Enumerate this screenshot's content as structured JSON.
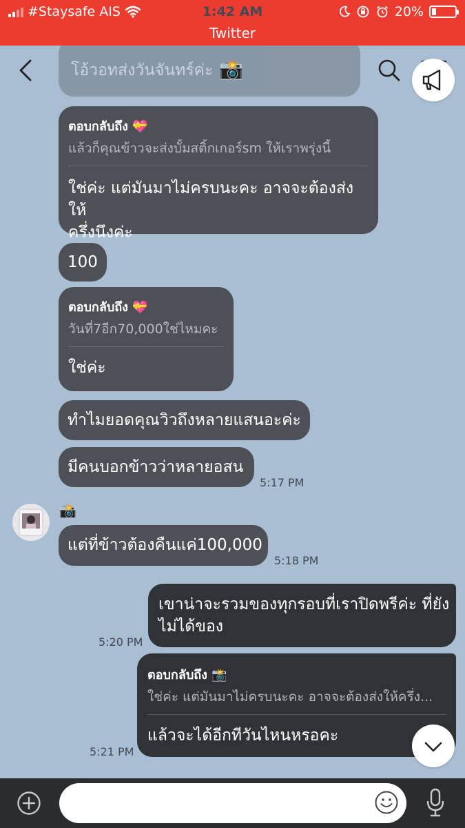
{
  "status_bar": {
    "carrier": "#Staysafe AIS",
    "time": "1:42 AM",
    "app": "Twitter",
    "battery": "20%",
    "battery_level": 0.2
  },
  "chat_title": "📸",
  "messages": [
    {
      "text": "โอ้วอทส่งวันจันทร์ค่ะ"
    },
    {
      "reply_label": "ตอบกลับถึง 💝",
      "quote": "แล้วก็คุณข้าวจะส่งบั้มสติ้กเกอร์sm ให้เราพรุ่งนี้",
      "line1": "ใช่ค่ะ แต่มันมาไม่ครบนะคะ อาจจะต้องส่งให้",
      "line2": "ครึ่งนึงค่ะ"
    },
    {
      "text": "100"
    },
    {
      "reply_label": "ตอบกลับถึง 💝",
      "quote": "วันที่7อีก70,000ใช่ไหมคะ",
      "text": "ใช่ค่ะ"
    },
    {
      "text": "ทำไมยอดคุณวิวถึงหลายแสนอะค่ะ"
    },
    {
      "text": "มีคนบอกข้าวว่าหลายอสน",
      "time": "5:17 PM"
    },
    {
      "sender": "📸",
      "text": "แต่ที่ข้าวต้องคืนแค่100,000",
      "time": "5:18 PM"
    },
    {
      "line1": "เขาน่าจะรวมของทุกรอบที่เราปิดพรีค่ะ ที่ยัง",
      "line2": "ไม่ได้ของ",
      "time": "5:20 PM"
    },
    {
      "reply_label": "ตอบกลับถึง 📸",
      "quote": "ใช่ค่ะ แต่มันมาไม่ครบนะคะ อาจจะต้องส่งให้ครึ่ง...",
      "text": "แล้วจะได้อีกทีวันไหนหรอคะ",
      "time": "5:21 PM"
    }
  ],
  "input": {
    "placeholder": ""
  },
  "icons": {
    "back": "chevron-left-icon",
    "search": "search-icon",
    "menu": "hamburger-menu-icon",
    "announcement": "megaphone-icon",
    "scroll_down": "chevron-down-icon",
    "plus": "plus-circle-icon",
    "emoji": "smiley-icon",
    "mic": "microphone-icon"
  },
  "colors": {
    "status_bar": "#ee3b30",
    "chat_bg": "#a9bed3",
    "incoming": "#4d5157",
    "outgoing": "#2f3236",
    "bottom_bar": "#2a2c2f"
  }
}
